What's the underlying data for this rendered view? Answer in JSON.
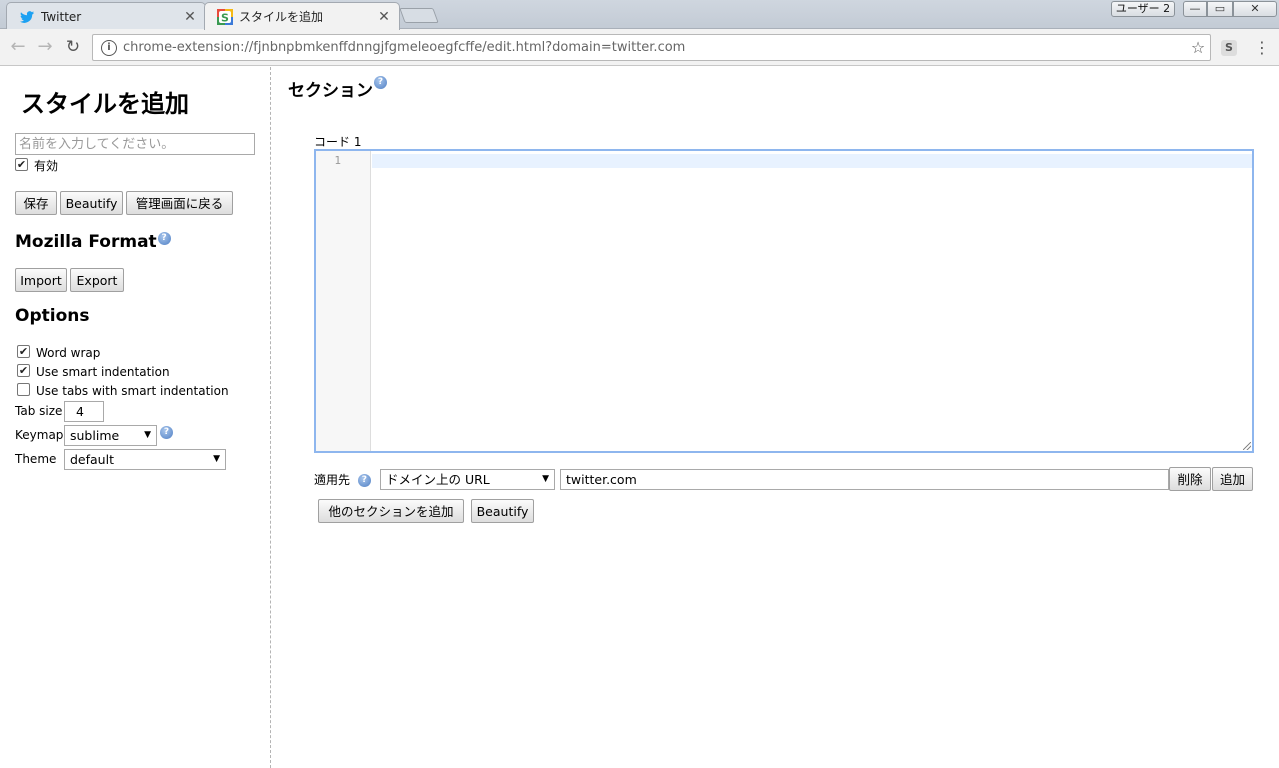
{
  "browser": {
    "tabs": [
      {
        "title": "Twitter",
        "active": false
      },
      {
        "title": "スタイルを追加",
        "active": true
      }
    ],
    "user_label": "ユーザー 2",
    "window_buttons": {
      "minimize": "—",
      "maximize": "▭",
      "close": "✕"
    },
    "url": "chrome-extension://fjnbnpbmkenffdnngjfgmeleoegfcffe/edit.html?domain=twitter.com",
    "extension_icon": "S",
    "icons": {
      "back": "back-arrow-icon",
      "forward": "forward-arrow-icon",
      "reload": "reload-icon",
      "star": "star-icon",
      "menu": "kebab-menu-icon"
    }
  },
  "sidebar": {
    "title": "スタイルを追加",
    "name_placeholder": "名前を入力してください。",
    "enabled_label": "有効",
    "enabled": true,
    "buttons": {
      "save": "保存",
      "beautify": "Beautify",
      "back_to_manage": "管理画面に戻る"
    },
    "mozilla_format": {
      "heading": "Mozilla Format",
      "import": "Import",
      "export": "Export"
    },
    "options": {
      "heading": "Options",
      "word_wrap": {
        "label": "Word wrap",
        "checked": true
      },
      "smart_indent": {
        "label": "Use smart indentation",
        "checked": true
      },
      "tabs_smart_indent": {
        "label": "Use tabs with smart indentation",
        "checked": false
      },
      "tab_size": {
        "label": "Tab size",
        "value": "4"
      },
      "keymap": {
        "label": "Keymap",
        "value": "sublime"
      },
      "theme": {
        "label": "Theme",
        "value": "default"
      }
    }
  },
  "main": {
    "sections_heading": "セクション",
    "code_label": "コード 1",
    "line_number": "1",
    "apply_label": "適用先",
    "apply_type": "ドメイン上の URL",
    "apply_value": "twitter.com",
    "remove_button": "削除",
    "add_button": "追加",
    "add_section_button": "他のセクションを追加",
    "beautify_button": "Beautify"
  },
  "colors": {
    "accent_border": "#8eb6ee",
    "active_line": "#e8f2ff",
    "help_icon": "#4f7fc4"
  }
}
